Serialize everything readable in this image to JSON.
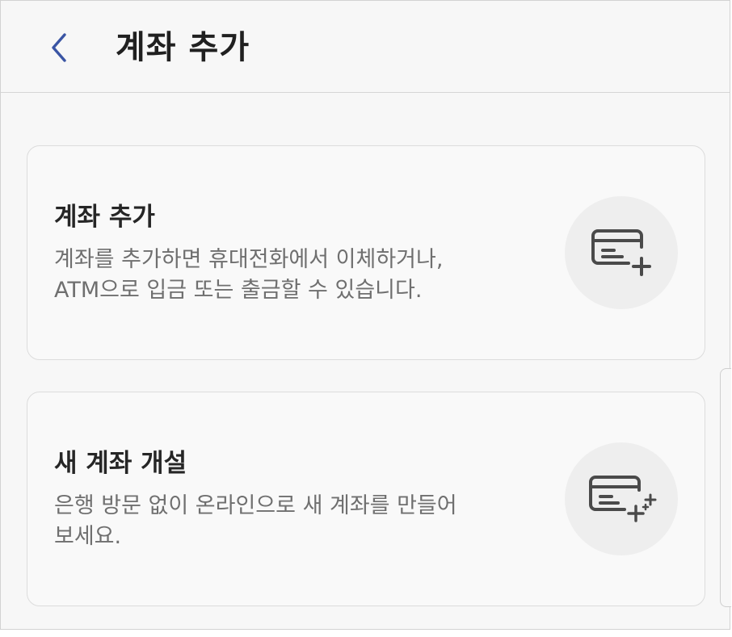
{
  "header": {
    "back_icon": "chevron-left-icon",
    "title": "계좌 추가"
  },
  "cards": [
    {
      "title": "계좌 추가",
      "desc_line1": "계좌를 추가하면 휴대전화에서 이체하거나,",
      "desc_line2": "ATM으로 입금 또는 출금할 수 있습니다.",
      "icon": "card-add-icon"
    },
    {
      "title": "새 계좌 개설",
      "desc_line1": "은행 방문 없이 온라인으로 새 계좌를 만들어",
      "desc_line2": "보세요.",
      "icon": "card-new-sparkle-icon"
    }
  ],
  "colors": {
    "accent": "#3a55a4",
    "background": "#f7f7f7",
    "title_text": "#202020",
    "desc_text": "#6f6f6f",
    "icon_stroke": "#4a4a4a"
  }
}
